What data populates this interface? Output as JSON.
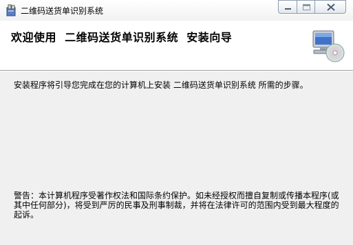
{
  "window": {
    "title": "二维码送货单识别系统",
    "icon": "installer-package-icon",
    "controls": [
      "minimize-icon",
      "maximize-icon",
      "close-icon"
    ]
  },
  "header": {
    "title": "欢迎使用  二维码送货单识别系统  安装向导",
    "graphic": "computer-cd-icon"
  },
  "content": {
    "intro": "安装程序将引导您完成在您的计算机上安装 二维码送货单识别系统 所需的步骤。",
    "warning": "警告：本计算机程序受著作权法和国际条约保护。如未经授权而擅自复制或传播本程序(或其中任何部分)，将受到严厉的民事及刑事制裁，并将在法律许可的范围内受到最大程度的起诉。"
  }
}
